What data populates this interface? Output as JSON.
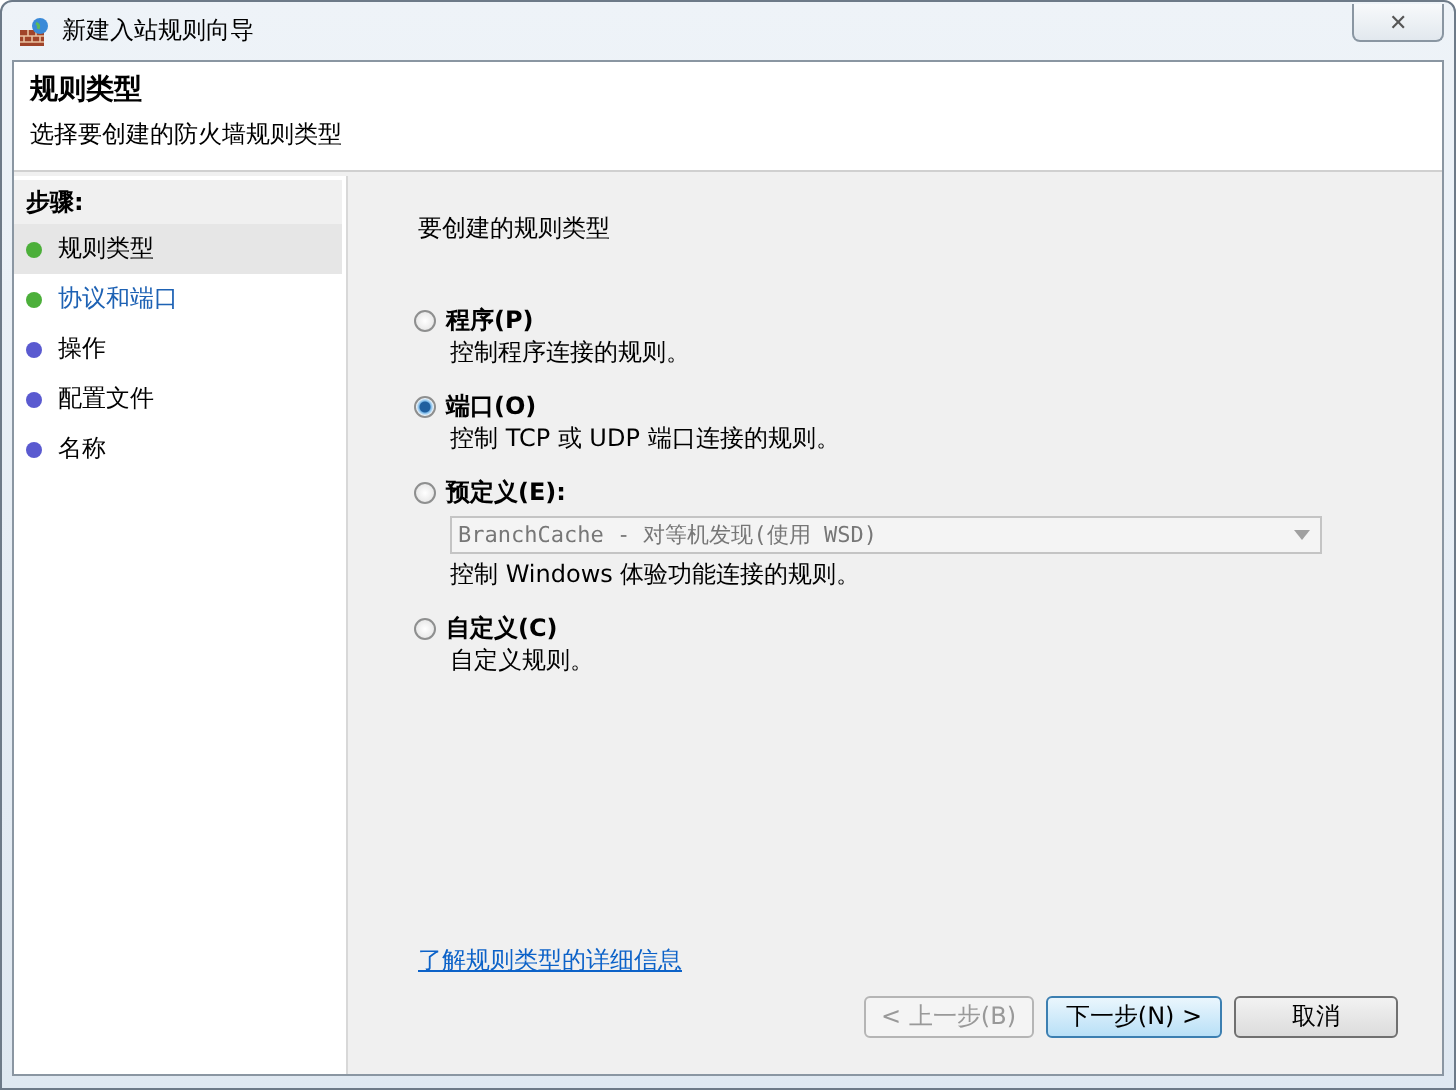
{
  "window": {
    "title": "新建入站规则向导",
    "close": "✕"
  },
  "header": {
    "title": "规则类型",
    "subtitle": "选择要创建的防火墙规则类型"
  },
  "steps": {
    "heading": "步骤:",
    "items": [
      {
        "label": "规则类型",
        "color": "#4caf3a",
        "selected": true,
        "kind": "plain"
      },
      {
        "label": "协议和端口",
        "color": "#4caf3a",
        "selected": false,
        "kind": "link"
      },
      {
        "label": "操作",
        "color": "#5a5ad0",
        "selected": false,
        "kind": "plain"
      },
      {
        "label": "配置文件",
        "color": "#5a5ad0",
        "selected": false,
        "kind": "plain"
      },
      {
        "label": "名称",
        "color": "#5a5ad0",
        "selected": false,
        "kind": "plain"
      }
    ]
  },
  "content": {
    "question": "要创建的规则类型",
    "options": [
      {
        "kind": "plain",
        "label": "程序(P)",
        "description": "控制程序连接的规则。",
        "selected": false
      },
      {
        "kind": "plain",
        "label": "端口(O)",
        "description": "控制 TCP 或 UDP 端口连接的规则。",
        "selected": true
      },
      {
        "kind": "dropdown",
        "label": "预定义(E):",
        "dropdown": {
          "value": "BranchCache - 对等机发现(使用 WSD)",
          "disabled": true
        },
        "description": "控制 Windows 体验功能连接的规则。",
        "selected": false
      },
      {
        "kind": "plain",
        "label": "自定义(C)",
        "description": "自定义规则。",
        "selected": false
      }
    ],
    "link": "了解规则类型的详细信息"
  },
  "buttons": [
    {
      "label": "< 上一步(B)",
      "disabled": true,
      "default": false
    },
    {
      "label": "下一步(N) >",
      "disabled": false,
      "default": true
    },
    {
      "label": "取消",
      "disabled": false,
      "default": false
    }
  ]
}
